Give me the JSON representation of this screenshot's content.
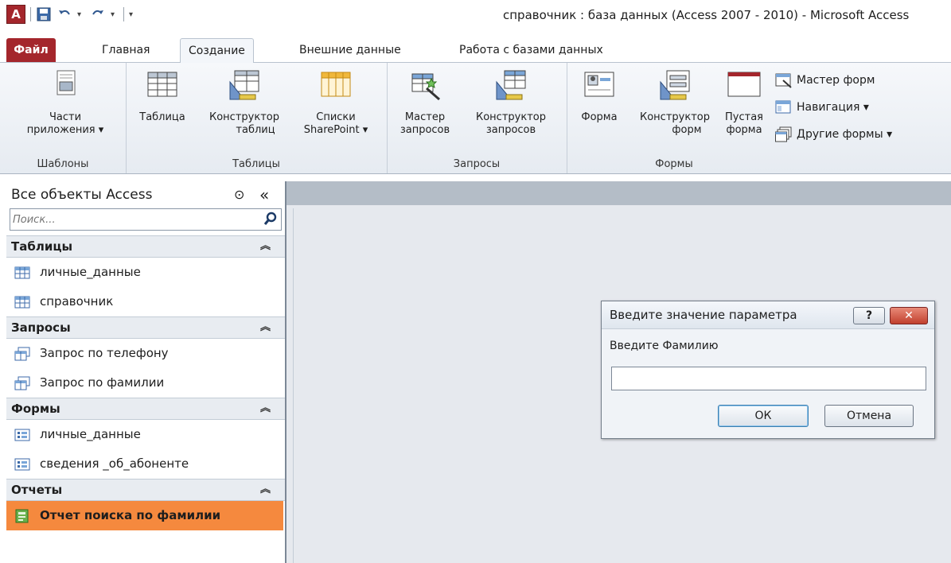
{
  "window": {
    "title": "справочник : база данных (Access 2007 - 2010)  -  Microsoft Access"
  },
  "qat": {
    "logo_letter": "A",
    "items": [
      "save-icon",
      "undo-icon",
      "redo-icon",
      "customize-icon"
    ]
  },
  "tabs": [
    {
      "label": "Файл"
    },
    {
      "label": "Главная"
    },
    {
      "label": "Создание"
    },
    {
      "label": "Внешние данные"
    },
    {
      "label": "Работа с базами данных"
    }
  ],
  "ribbon": {
    "groups": {
      "templates": {
        "label": "Шаблоны"
      },
      "tables": {
        "label": "Таблицы"
      },
      "queries": {
        "label": "Запросы"
      },
      "forms": {
        "label": "Формы"
      }
    },
    "buttons": {
      "app_parts": {
        "line1": "Части",
        "line2": "приложения ▾"
      },
      "table": {
        "line1": "Таблица"
      },
      "table_designer": {
        "line1": "Конструктор",
        "line2": "таблиц"
      },
      "sharepoint_lists": {
        "line1": "Списки",
        "line2": "SharePoint ▾"
      },
      "query_wizard": {
        "line1": "Мастер",
        "line2": "запросов"
      },
      "query_designer": {
        "line1": "Конструктор",
        "line2": "запросов"
      },
      "form": {
        "line1": "Форма"
      },
      "form_designer": {
        "line1": "Конструктор",
        "line2": "форм"
      },
      "blank_form": {
        "line1": "Пустая",
        "line2": "форма"
      },
      "form_wizard": {
        "label": "Мастер форм"
      },
      "navigation": {
        "label": "Навигация ▾"
      },
      "more_forms": {
        "label": "Другие формы ▾"
      }
    }
  },
  "navpane": {
    "header": "Все объекты Access",
    "menu_glyph": "⊙",
    "collapse_glyph": "«",
    "search_placeholder": "Поиск...",
    "sections": [
      {
        "title": "Таблицы",
        "items": [
          {
            "label": "личные_данные",
            "icon": "table-icon"
          },
          {
            "label": "справочник",
            "icon": "table-icon"
          }
        ]
      },
      {
        "title": "Запросы",
        "items": [
          {
            "label": "Запрос по телефону",
            "icon": "query-icon"
          },
          {
            "label": "Запрос по фамилии",
            "icon": "query-icon"
          }
        ]
      },
      {
        "title": "Формы",
        "items": [
          {
            "label": "личные_данные",
            "icon": "form-icon"
          },
          {
            "label": "сведения _об_абоненте",
            "icon": "form-icon"
          }
        ]
      },
      {
        "title": "Отчеты",
        "items": [
          {
            "label": "Отчет поиска по фамилии",
            "icon": "report-icon",
            "selected": true
          }
        ]
      }
    ],
    "section_chevron": "≈"
  },
  "dialog": {
    "title": "Введите значение параметра",
    "help_glyph": "?",
    "close_glyph": "✕",
    "prompt": "Введите Фамилию",
    "input_value": "",
    "ok_label": "ОК",
    "cancel_label": "Отмена"
  },
  "colors": {
    "file_tab": "#a4262c",
    "selected_item": "#f5893e"
  }
}
